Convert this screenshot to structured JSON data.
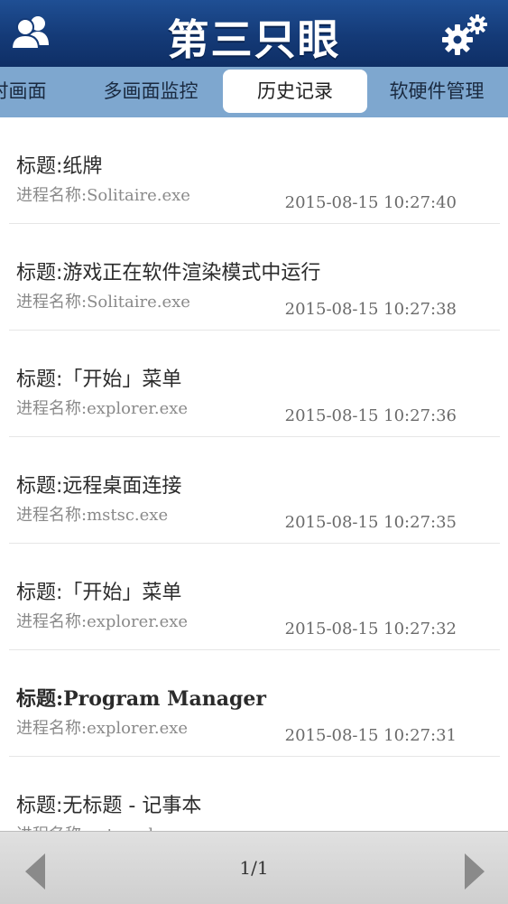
{
  "header": {
    "logo_text": "第三只眼",
    "user_icon": "users-icon",
    "settings_icon": "gears-icon"
  },
  "tabs": [
    {
      "label": "时画面",
      "active": false
    },
    {
      "label": "多画面监控",
      "active": false
    },
    {
      "label": "历史记录",
      "active": true
    },
    {
      "label": "软硬件管理",
      "active": false
    }
  ],
  "records": [
    {
      "title": "标题:纸牌",
      "process": "进程名称:Solitaire.exe",
      "time": "2015-08-15 10:27:40"
    },
    {
      "title": "标题:游戏正在软件渲染模式中运行",
      "process": "进程名称:Solitaire.exe",
      "time": "2015-08-15 10:27:38"
    },
    {
      "title": "标题:「开始」菜单",
      "process": "进程名称:explorer.exe",
      "time": "2015-08-15 10:27:36"
    },
    {
      "title": "标题:远程桌面连接",
      "process": "进程名称:mstsc.exe",
      "time": "2015-08-15 10:27:35"
    },
    {
      "title": "标题:「开始」菜单",
      "process": "进程名称:explorer.exe",
      "time": "2015-08-15 10:27:32"
    },
    {
      "title": "标题:Program Manager",
      "process": "进程名称:explorer.exe",
      "time": "2015-08-15 10:27:31"
    },
    {
      "title": "标题:无标题 - 记事本",
      "process": "进程名称:notepad.exe",
      "time": ""
    }
  ],
  "footer": {
    "page_indicator": "1/1",
    "prev_icon": "arrow-left-icon",
    "next_icon": "arrow-right-icon"
  },
  "colors": {
    "header_bg": "#143a77",
    "tab_bar_bg": "#7ea7cf",
    "active_tab_bg": "#ffffff"
  }
}
